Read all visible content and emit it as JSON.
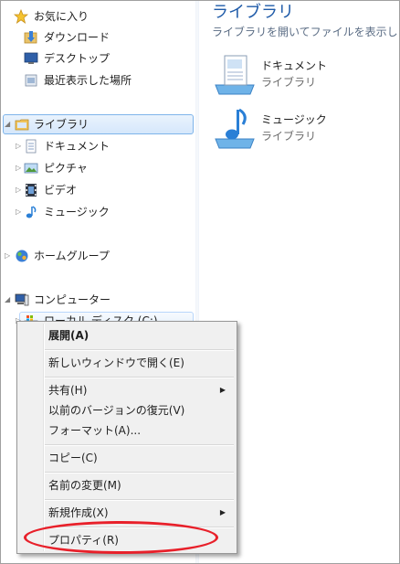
{
  "nav": {
    "favorites": {
      "label": "お気に入り",
      "icon": "star-icon",
      "items": [
        {
          "label": "ダウンロード",
          "icon": "download-folder-icon"
        },
        {
          "label": "デスクトップ",
          "icon": "desktop-icon"
        },
        {
          "label": "最近表示した場所",
          "icon": "recent-places-icon"
        }
      ]
    },
    "libraries": {
      "label": "ライブラリ",
      "icon": "library-folder-icon",
      "items": [
        {
          "label": "ドキュメント",
          "icon": "document-icon"
        },
        {
          "label": "ピクチャ",
          "icon": "picture-icon"
        },
        {
          "label": "ビデオ",
          "icon": "video-icon"
        },
        {
          "label": "ミュージック",
          "icon": "music-icon"
        }
      ]
    },
    "homegroup": {
      "label": "ホームグループ",
      "icon": "homegroup-icon"
    },
    "computer": {
      "label": "コンピューター",
      "icon": "computer-icon",
      "items": [
        {
          "label": "ローカル ディスク (C:)",
          "icon": "drive-icon"
        }
      ]
    }
  },
  "content": {
    "title": "ライブラリ",
    "subtitle": "ライブラリを開いてファイルを表示し",
    "libraries": [
      {
        "name": "ドキュメント",
        "kind": "ライブラリ",
        "icon": "documents-library-icon"
      },
      {
        "name": "ミュージック",
        "kind": "ライブラリ",
        "icon": "music-library-icon"
      }
    ]
  },
  "context_menu": {
    "expand": "展開(A)",
    "open_new_window": "新しいウィンドウで開く(E)",
    "share": "共有(H)",
    "restore_previous": "以前のバージョンの復元(V)",
    "format": "フォーマット(A)...",
    "copy": "コピー(C)",
    "rename": "名前の変更(M)",
    "new": "新規作成(X)",
    "properties": "プロパティ(R)"
  },
  "colors": {
    "accent": "#1e5aa8",
    "highlight_oval": "#e8202a",
    "selection": "#d5e7fb"
  }
}
